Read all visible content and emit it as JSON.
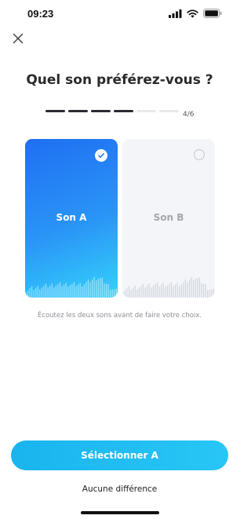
{
  "status_bar": {
    "time": "09:23",
    "icons": [
      "signal-icon",
      "wifi-icon",
      "battery-icon"
    ]
  },
  "header": {
    "close_icon": "close-icon",
    "title": "Quel son préférez-vous ?"
  },
  "progress": {
    "current": 4,
    "total": 6,
    "label": "4/6"
  },
  "cards": [
    {
      "label": "Son A",
      "selected": true,
      "indicator_icon": "check-circle-icon"
    },
    {
      "label": "Son B",
      "selected": false,
      "indicator_icon": "radio-empty-icon"
    }
  ],
  "hint": "Écoutez les deux sons avant de faire votre choix.",
  "actions": {
    "primary_label": "Sélectionner A",
    "secondary_label": "Aucune différence"
  },
  "colors": {
    "card_selected_start": "#1f6ff2",
    "card_selected_end": "#34d2fb",
    "card_unselected": "#f3f5f8",
    "primary_button": "#1ab4ee",
    "title": "#2a2a2a",
    "progress_active": "#2b2b33",
    "progress_inactive": "#e9e9ec"
  }
}
